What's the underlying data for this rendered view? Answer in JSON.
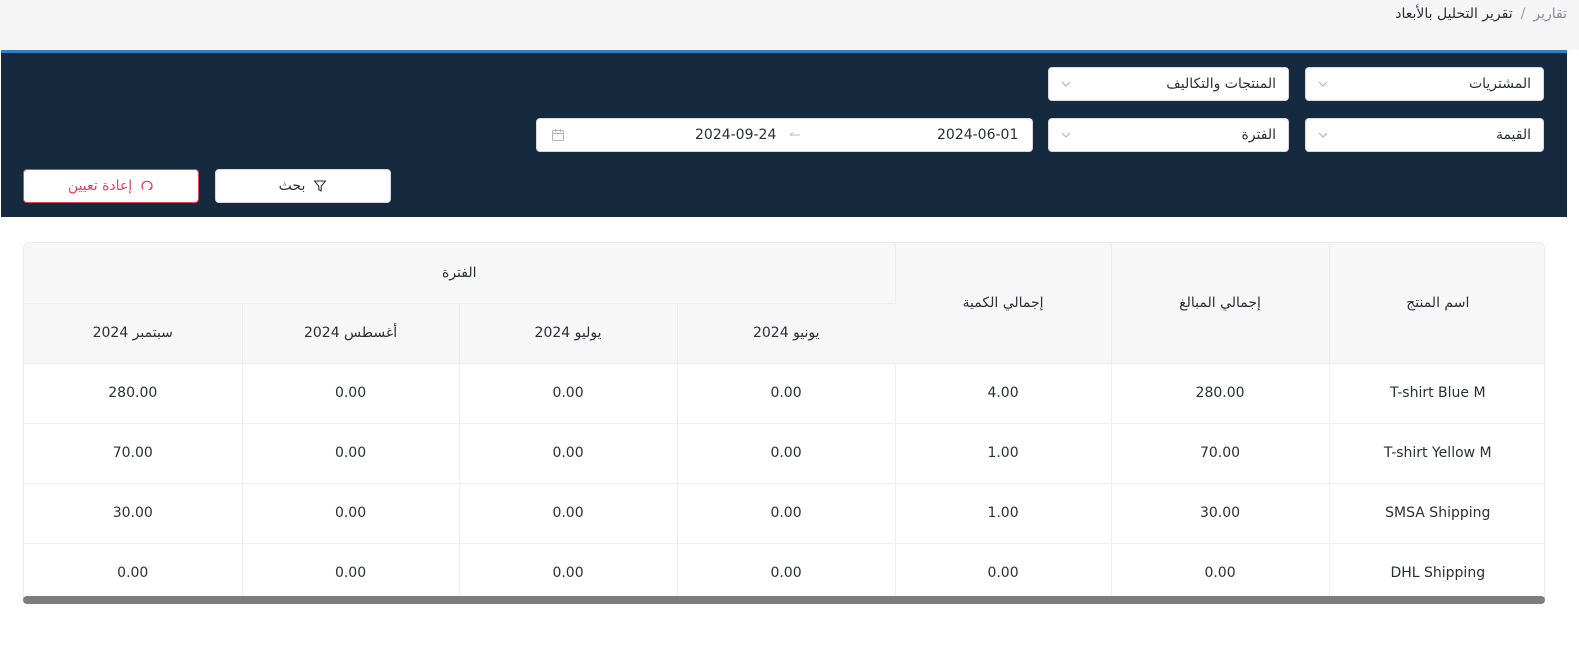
{
  "breadcrumb": {
    "parent": "تقارير",
    "separator": "/",
    "current": "تقرير التحليل بالأبعاد"
  },
  "filters": {
    "report_source": "المشتريات",
    "dimension": "المنتجات والتكاليف",
    "measure": "القيمة",
    "group_by": "الفترة",
    "date_from": "2024-06-01",
    "date_to": "2024-09-24",
    "search_label": "بحث",
    "reset_label": "إعادة تعيين"
  },
  "table": {
    "headers": {
      "product_name": "اسم المنتج",
      "total_amount": "إجمالي المبالغ",
      "total_quantity": "إجمالي الكمية",
      "period": "الفترة",
      "months": [
        "يونيو 2024",
        "يوليو 2024",
        "أغسطس 2024",
        "سبتمبر 2024"
      ]
    },
    "rows": [
      {
        "product": "T-shirt Blue M",
        "total_amount": "280.00",
        "total_quantity": "4.00",
        "months": [
          "0.00",
          "0.00",
          "0.00",
          "280.00"
        ]
      },
      {
        "product": "T-shirt Yellow M",
        "total_amount": "70.00",
        "total_quantity": "1.00",
        "months": [
          "0.00",
          "0.00",
          "0.00",
          "70.00"
        ]
      },
      {
        "product": "SMSA Shipping",
        "total_amount": "30.00",
        "total_quantity": "1.00",
        "months": [
          "0.00",
          "0.00",
          "0.00",
          "30.00"
        ]
      },
      {
        "product": "DHL Shipping",
        "total_amount": "0.00",
        "total_quantity": "0.00",
        "months": [
          "0.00",
          "0.00",
          "0.00",
          "0.00"
        ]
      }
    ]
  },
  "colors": {
    "panel_bg": "#152a3f",
    "accent": "#2f7fc1",
    "reset": "#e0435a"
  },
  "icons": {
    "chevron": "chevron-down-icon",
    "calendar": "calendar-icon",
    "arrow": "arrow-left-icon",
    "filter": "filter-icon",
    "reset": "reset-icon"
  }
}
